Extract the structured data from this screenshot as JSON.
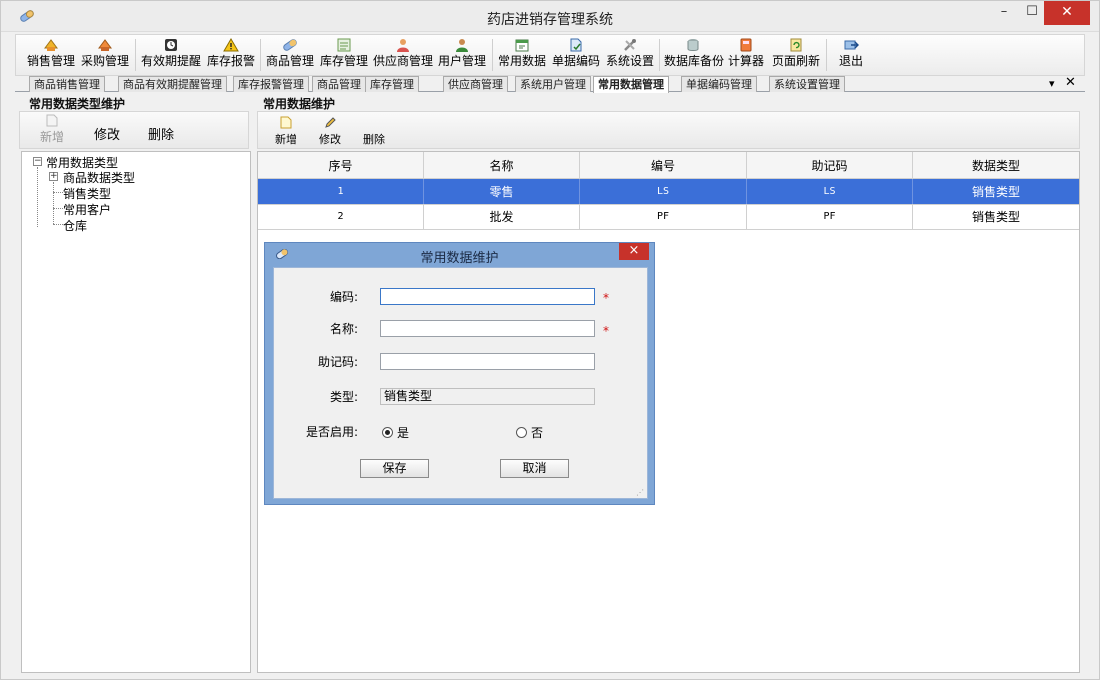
{
  "window": {
    "title": "药店进销存管理系统"
  },
  "toolbar": {
    "items": [
      {
        "label": "销售管理",
        "icon": "sales-icon"
      },
      {
        "label": "采购管理",
        "icon": "purchase-icon"
      },
      {
        "label": "有效期提醒",
        "icon": "alarm-clock-icon"
      },
      {
        "label": "库存报警",
        "icon": "warning-icon"
      },
      {
        "label": "商品管理",
        "icon": "product-icon"
      },
      {
        "label": "库存管理",
        "icon": "inventory-icon"
      },
      {
        "label": "供应商管理",
        "icon": "supplier-icon"
      },
      {
        "label": "用户管理",
        "icon": "user-icon"
      },
      {
        "label": "常用数据",
        "icon": "calendar-icon"
      },
      {
        "label": "单据编码",
        "icon": "document-icon"
      },
      {
        "label": "系统设置",
        "icon": "settings-icon"
      },
      {
        "label": "数据库备份",
        "icon": "database-icon"
      },
      {
        "label": "计算器",
        "icon": "calculator-icon"
      },
      {
        "label": "页面刷新",
        "icon": "refresh-icon"
      },
      {
        "label": "退出",
        "icon": "exit-icon"
      }
    ]
  },
  "tabs": [
    "商品销售管理",
    "商品有效期提醒管理",
    "库存报警管理",
    "商品管理",
    "库存管理",
    "供应商管理",
    "系统用户管理",
    "常用数据管理",
    "单据编码管理",
    "系统设置管理"
  ],
  "active_tab": "常用数据管理",
  "left_panel": {
    "title": "常用数据类型维护",
    "buttons": {
      "add": "新增",
      "edit": "修改",
      "delete": "删除"
    },
    "tree": {
      "root": "常用数据类型",
      "children": [
        "商品数据类型",
        "销售类型",
        "常用客户",
        "仓库"
      ]
    }
  },
  "right_panel": {
    "title": "常用数据维护",
    "buttons": {
      "add": "新增",
      "edit": "修改",
      "delete": "删除"
    },
    "grid": {
      "columns": [
        "序号",
        "名称",
        "编号",
        "助记码",
        "数据类型"
      ],
      "rows": [
        {
          "no": "1",
          "name": "零售",
          "code": "LS",
          "mnemonic": "LS",
          "type": "销售类型",
          "selected": true
        },
        {
          "no": "2",
          "name": "批发",
          "code": "PF",
          "mnemonic": "PF",
          "type": "销售类型",
          "selected": false
        }
      ]
    }
  },
  "dialog": {
    "title": "常用数据维护",
    "close_glyph": "×",
    "required_mark": "*",
    "fields": {
      "code_label": "编码:",
      "code_value": "",
      "name_label": "名称:",
      "name_value": "",
      "mnemonic_label": "助记码:",
      "mnemonic_value": "",
      "type_label": "类型:",
      "type_value": "销售类型",
      "enabled_label": "是否启用:",
      "enabled_yes": "是",
      "enabled_no": "否",
      "enabled": true
    },
    "buttons": {
      "save": "保存",
      "cancel": "取消"
    }
  },
  "colors": {
    "selection": "#3b6fd8",
    "dialog_frame": "#7fa6d6",
    "close": "#c7322a"
  }
}
